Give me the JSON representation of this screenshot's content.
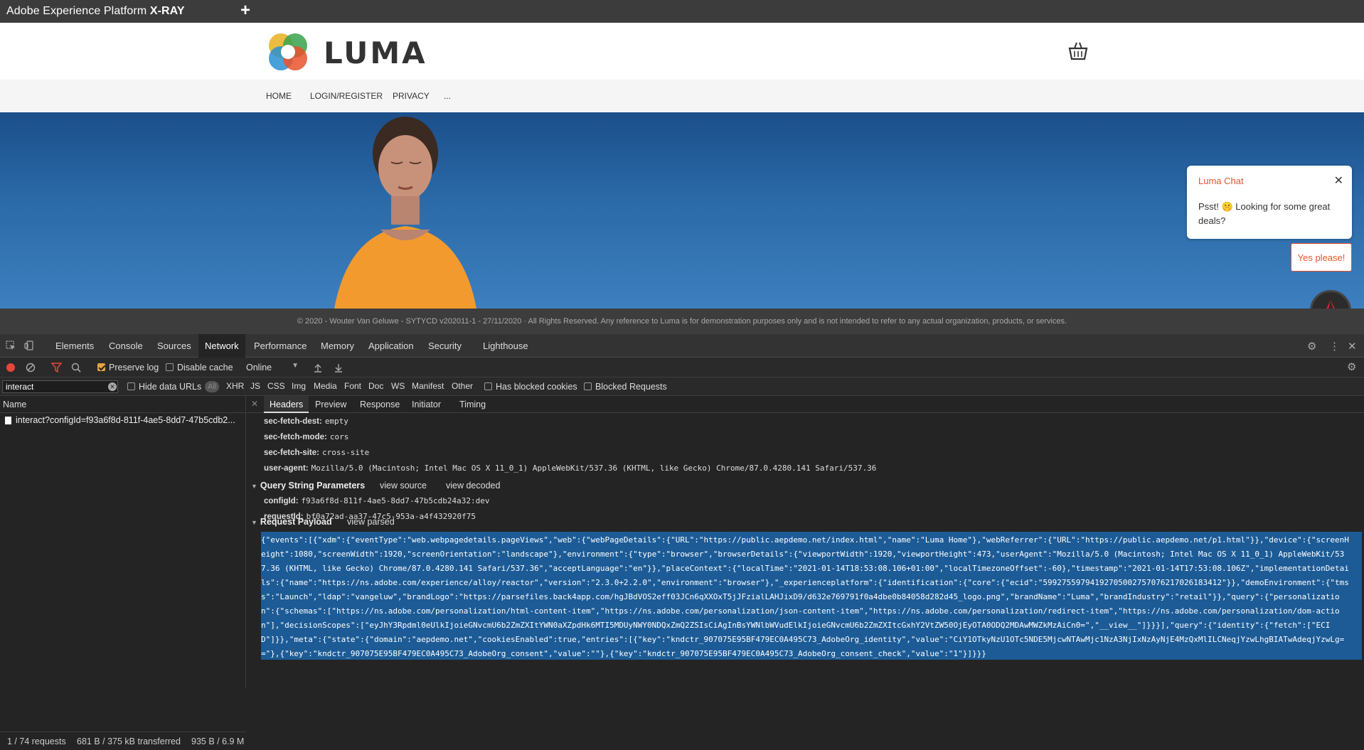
{
  "app": {
    "title_normal": "Adobe Experience Platform ",
    "title_bold": "X-RAY",
    "new_tab": "+"
  },
  "site": {
    "brand": "LUMA",
    "nav": [
      "HOME",
      "LOGIN/REGISTER",
      "PRIVACY",
      "..."
    ],
    "chat": {
      "title": "Luma Chat",
      "close": "✕",
      "message": "Psst! 🤫 Looking for some great deals?",
      "button": "Yes please!"
    },
    "footer": "© 2020 - Wouter Van Geluwe - SYTYCD v202011-1 - 27/11/2020 · All Rights Reserved. Any reference to Luma is for demonstration purposes only and is not intended to refer to any actual organization, products, or services."
  },
  "devtools": {
    "tabs": [
      "Elements",
      "Console",
      "Sources",
      "Network",
      "Performance",
      "Memory",
      "Application",
      "Security",
      "Lighthouse"
    ],
    "active_tab": "Network",
    "toolbar": {
      "preserve_log": "Preserve log",
      "disable_cache": "Disable cache",
      "throttle": "Online"
    },
    "filter": {
      "value": "interact",
      "hide_data_urls": "Hide data URLs",
      "all": "All",
      "types": [
        "XHR",
        "JS",
        "CSS",
        "Img",
        "Media",
        "Font",
        "Doc",
        "WS",
        "Manifest",
        "Other"
      ],
      "has_blocked_cookies": "Has blocked cookies",
      "blocked_requests": "Blocked Requests"
    },
    "requests": {
      "header": "Name",
      "rows": [
        "interact?configId=f93a6f8d-811f-4ae5-8dd7-47b5cdb2..."
      ]
    },
    "status": {
      "requests": "1 / 74 requests",
      "transferred": "681 B / 375 kB transferred",
      "resources": "935 B / 6.9 M"
    },
    "detail_tabs": [
      "Headers",
      "Preview",
      "Response",
      "Initiator",
      "Timing"
    ],
    "headers": [
      {
        "key": "sec-fetch-dest:",
        "value": "empty"
      },
      {
        "key": "sec-fetch-mode:",
        "value": "cors"
      },
      {
        "key": "sec-fetch-site:",
        "value": "cross-site"
      },
      {
        "key": "user-agent:",
        "value": "Mozilla/5.0 (Macintosh; Intel Mac OS X 11_0_1) AppleWebKit/537.36 (KHTML, like Gecko) Chrome/87.0.4280.141 Safari/537.36"
      }
    ],
    "query": {
      "title": "Query String Parameters",
      "view_source": "view source",
      "view_decoded": "view decoded",
      "params": [
        {
          "key": "configId:",
          "value": "f93a6f8d-811f-4ae5-8dd7-47b5cdb24a32:dev"
        },
        {
          "key": "requestId:",
          "value": "bf0a72ad-aa37-47c5-953a-a4f432920f75"
        }
      ]
    },
    "payload": {
      "title": "Request Payload",
      "view_parsed": "view parsed",
      "lines": [
        "{\"events\":[{\"xdm\":{\"eventType\":\"web.webpagedetails.pageViews\",\"web\":{\"webPageDetails\":{\"URL\":\"https://public.aepdemo.net/index.html\",\"name\":\"Luma Home\"},\"webReferrer\":{\"URL\":\"https://public.aepdemo.net/p1.html\"}},\"device\":{\"screenH",
        "eight\":1080,\"screenWidth\":1920,\"screenOrientation\":\"landscape\"},\"environment\":{\"type\":\"browser\",\"browserDetails\":{\"viewportWidth\":1920,\"viewportHeight\":473,\"userAgent\":\"Mozilla/5.0 (Macintosh; Intel Mac OS X 11_0_1) AppleWebKit/53",
        "7.36 (KHTML, like Gecko) Chrome/87.0.4280.141 Safari/537.36\",\"acceptLanguage\":\"en\"}},\"placeContext\":{\"localTime\":\"2021-01-14T18:53:08.106+01:00\",\"localTimezoneOffset\":-60},\"timestamp\":\"2021-01-14T17:53:08.106Z\",\"implementationDetai",
        "ls\":{\"name\":\"https://ns.adobe.com/experience/alloy/reactor\",\"version\":\"2.3.0+2.2.0\",\"environment\":\"browser\"},\"_experienceplatform\":{\"identification\":{\"core\":{\"ecid\":\"59927559794192705002757076217026183412\"}},\"demoEnvironment\":{\"tms",
        "s\":\"Launch\",\"ldap\":\"vangeluw\",\"brandLogo\":\"https://parsefiles.back4app.com/hgJBdVOS2eff03JCn6qXXOxT5jJFzialLAHJixD9/d632e769791f0a4dbe0b84058d282d45_logo.png\",\"brandName\":\"Luma\",\"brandIndustry\":\"retail\"}},\"query\":{\"personalizatio",
        "n\":{\"schemas\":[\"https://ns.adobe.com/personalization/html-content-item\",\"https://ns.adobe.com/personalization/json-content-item\",\"https://ns.adobe.com/personalization/redirect-item\",\"https://ns.adobe.com/personalization/dom-actio",
        "n\"],\"decisionScopes\":[\"eyJhY3Rpdml0eUlkIjoieGNvcmU6b2ZmZXItYWN0aXZpdHk6MTI5MDUyNWY0NDQxZmQ2ZSIsCiAgInBsYWNlbWVudElkIjoieGNvcmU6b2ZmZXItcGxhY2VtZW50OjEyOTA0ODQ2MDAwMWZkMzAiCn0=\",\"__view__\"]}}}],\"query\":{\"identity\":{\"fetch\":[\"ECI",
        "D\"]}},\"meta\":{\"state\":{\"domain\":\"aepdemo.net\",\"cookiesEnabled\":true,\"entries\":[{\"key\":\"kndctr_907075E95BF479EC0A495C73_AdobeOrg_identity\",\"value\":\"CiY1OTkyNzU1OTc5NDE5MjcwNTAwMjc1NzA3NjIxNzAyNjE4MzQxMlILCNeqjYzwLhgBIATwAdeqjYzwLg=",
        "=\"},{\"key\":\"kndctr_907075E95BF479EC0A495C73_AdobeOrg_consent\",\"value\":\"\"},{\"key\":\"kndctr_907075E95BF479EC0A495C73_AdobeOrg_consent_check\",\"value\":\"1\"}]}}}"
      ]
    }
  }
}
